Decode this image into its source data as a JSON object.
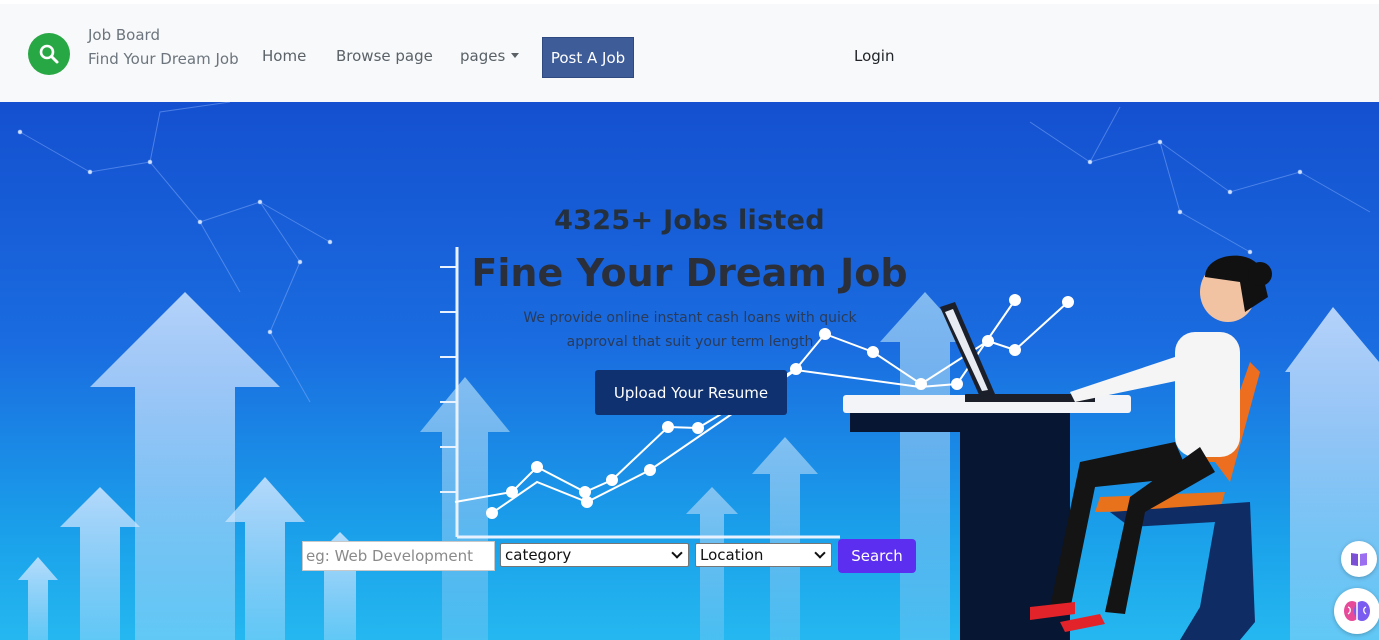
{
  "navbar": {
    "brand_title": "Job Board",
    "brand_subtitle": "Find Your Dream Job",
    "logo_icon": "search-icon",
    "links": {
      "home": "Home",
      "browse": "Browse page",
      "pages": "pages"
    },
    "post_job": "Post A Job",
    "login": "Login"
  },
  "hero": {
    "jobs_count": "4325+ Jobs listed",
    "title": "Fine Your Dream Job",
    "description": "We provide online instant cash loans with quick approval that suit your term length",
    "upload_button": "Upload Your Resume"
  },
  "search": {
    "keyword_placeholder": "eg: Web Development",
    "category_selected": "category",
    "location_selected": "Location",
    "search_button": "Search"
  },
  "colors": {
    "nav_bg": "#f8f9fa",
    "logo_green": "#28a745",
    "post_job_bg": "#3e5c98",
    "upload_bg": "#0f3170",
    "search_bg": "#5b2ef0",
    "hero_top": "#1450d0",
    "hero_bottom": "#25b8f0"
  },
  "widgets": {
    "book_icon": "book-icon",
    "brain_icon": "brain-icon"
  }
}
